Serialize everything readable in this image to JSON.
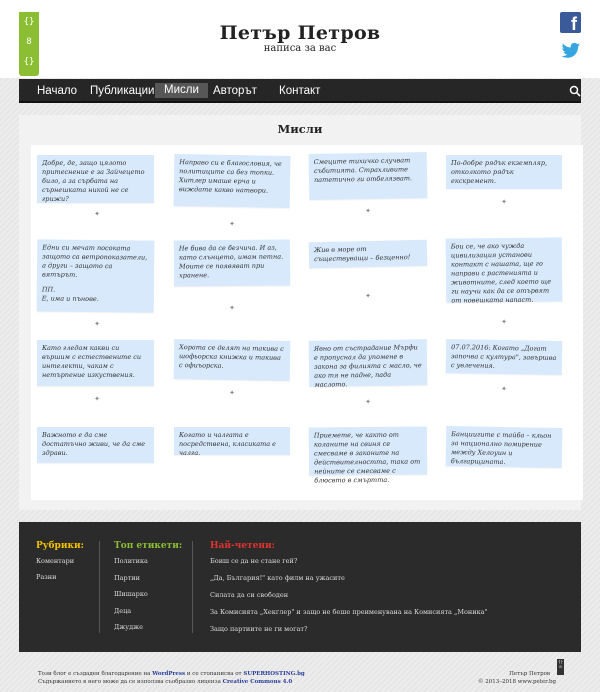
{
  "header": {
    "title": "Петър Петров",
    "subtitle": "написа за вас",
    "logo_text": [
      "{}",
      "8",
      "{}"
    ]
  },
  "social": {
    "facebook": "f"
  },
  "nav": {
    "items": [
      "Начало",
      "Публикации",
      "Мисли",
      "Авторът",
      "Контакт"
    ],
    "active": "Мисли"
  },
  "page": {
    "title": "Мисли"
  },
  "notes": [
    {
      "text": [
        "Добре, де, защо цялото притеснение е за Зайчецето било, а за сърбата на сърнешката никой не се грижи?"
      ]
    },
    {
      "text": [
        "Направо си е благословия, че политиците са без топки. Хитлер имаше ерча и виждате какво натвори."
      ]
    },
    {
      "text": [
        "Смеците тихичко случват събитията. Страхливите патетично ги отбелязват."
      ]
    },
    {
      "text": [
        "По-добре рядък екземпляр, отколкото рядък екскремент."
      ]
    },
    {
      "text": [
        "Едни си мечат посоката защото са ветропоказатели, а други – защото са вятърът.",
        "ПП.",
        "Е, има и пънове."
      ]
    },
    {
      "text": [
        "Не бива да се безчича. И аз, като слънцето, имам петна. Моите се появяват при хранене."
      ]
    },
    {
      "text": [
        "Жив в море от съществуващи – безценно!"
      ]
    },
    {
      "text": [
        "Бои се, че ако чужда цивилизация установи контакт с нашата, ще го направи с растенията и животните, след което ще ги научи как да се отървят от новешката напаст."
      ]
    },
    {
      "text": [
        "Като гледам какви си вършим с естествените си интелекти, чакам с нетърпение изкуствения."
      ]
    },
    {
      "text": [
        "Хората се делят на такива с шофьорска книжка и такива с офиъорска."
      ]
    },
    {
      "text": [
        "Явно от състраданиe Мърфи е пропуснал да упомене в закона за филията с масло, че ако тя не падне, пада маслото."
      ]
    },
    {
      "text": [
        "07.07.2016: Когато „Догат започва с култура\", завършва с увлечения."
      ]
    },
    {
      "text": [
        "Важното е да сме достатъчно живи, че да сме здрави."
      ]
    },
    {
      "text": [
        "Когато и чалгата е посредствена, класиката е чалга."
      ]
    },
    {
      "text": [
        "Приемете, че както от коланите на свиня се смесваме в законите на действителността, така от нейните се смесваме с блюсвто в смъртта."
      ]
    },
    {
      "text": [
        "Банциигите с тайба – кльон за национално помирение между Хелоуин и българщината."
      ]
    }
  ],
  "footer": {
    "rubrics": {
      "heading": "Рубрики:",
      "items": [
        "Коментари",
        "Разни"
      ]
    },
    "tags": {
      "heading": "Топ етикети:",
      "items": [
        "Политика",
        "Партии",
        "Шишарко",
        "Деца",
        "Джуджe"
      ]
    },
    "popular": {
      "heading": "Най-четени:",
      "items": [
        "Боиш се да не стане гей?",
        "„Да, България!\" като филм на ужасите",
        "Силата да си свободен",
        "За Комисията „Хекглер\" и защо не беше преименувана на Комисията „Моника\"",
        "Защо партиите не ги могат?"
      ]
    }
  },
  "bottom": {
    "line1_pre": "Този блог е създаден благодарение на ",
    "wordpress": "WordPress",
    "line1_mid": " и се стопанисва от ",
    "superhosting": "SUPERHOSTING.bg",
    "line2_pre": "Съдържанието в него може да се използва съобразно лиценза ",
    "license": "Creative Commons 4.0",
    "author": "Петър Петров",
    "copy": "© 2013–2018 www.peter.bg"
  },
  "colors": {
    "accent": "#8cbe34",
    "note_bg": "#d7e9fb",
    "rubrics": "#f2c200",
    "tags": "#8cbe34",
    "popular": "#e0332f"
  }
}
